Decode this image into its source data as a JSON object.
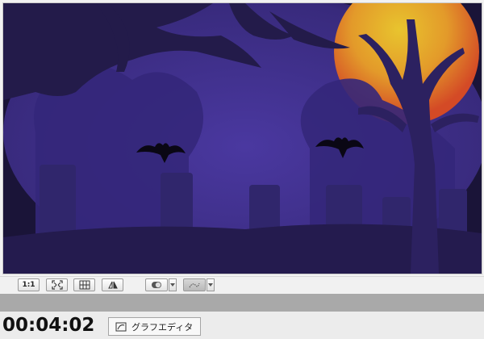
{
  "toolbar": {
    "actual_size_label": "1:1",
    "fit_icon": "fit-window-icon",
    "grid_icon": "grid-icon",
    "flip_icon": "flip-icon",
    "toggle_icon": "toggle-icon",
    "motion_path_icon": "motion-path-icon"
  },
  "status": {
    "timecode": "00:04:02",
    "graph_editor_label": "グラフエディタ"
  },
  "colors": {
    "sky": "#3f2d85",
    "moon_inner": "#e8b82c",
    "moon_outer": "#d8522a",
    "silhouette": "#2a1f55",
    "ground": "#221a48"
  }
}
